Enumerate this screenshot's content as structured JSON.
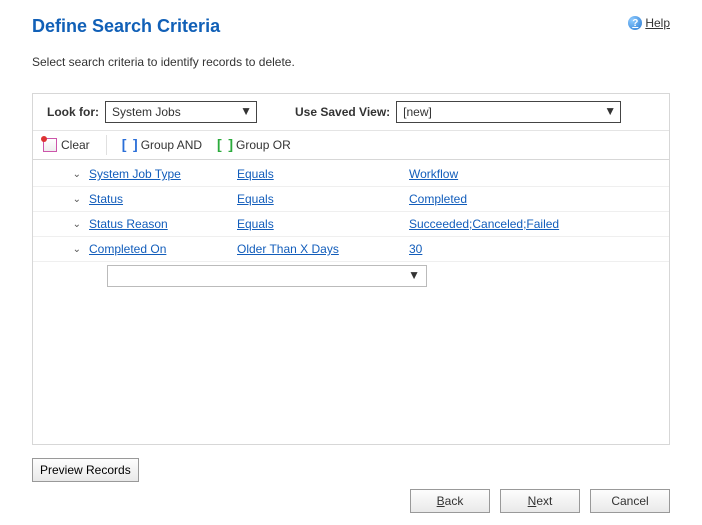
{
  "title": "Define Search Criteria",
  "help_label": "Help",
  "instruction": "Select search criteria to identify records to delete.",
  "look_for_label": "Look for:",
  "look_for_value": "System Jobs",
  "use_view_label": "Use Saved View:",
  "use_view_value": "[new]",
  "toolbar": {
    "clear": "Clear",
    "group_and": "Group AND",
    "group_or": "Group OR"
  },
  "rows": [
    {
      "field": "System Job Type",
      "op": "Equals",
      "val": "Workflow"
    },
    {
      "field": "Status",
      "op": "Equals",
      "val": "Completed"
    },
    {
      "field": "Status Reason",
      "op": "Equals",
      "val": "Succeeded;Canceled;Failed"
    },
    {
      "field": "Completed On",
      "op": "Older Than X Days",
      "val": "30"
    }
  ],
  "preview_label": "Preview Records",
  "buttons": {
    "back": "ack",
    "back_u": "B",
    "next": "ext",
    "next_u": "N",
    "cancel": "Cancel"
  }
}
